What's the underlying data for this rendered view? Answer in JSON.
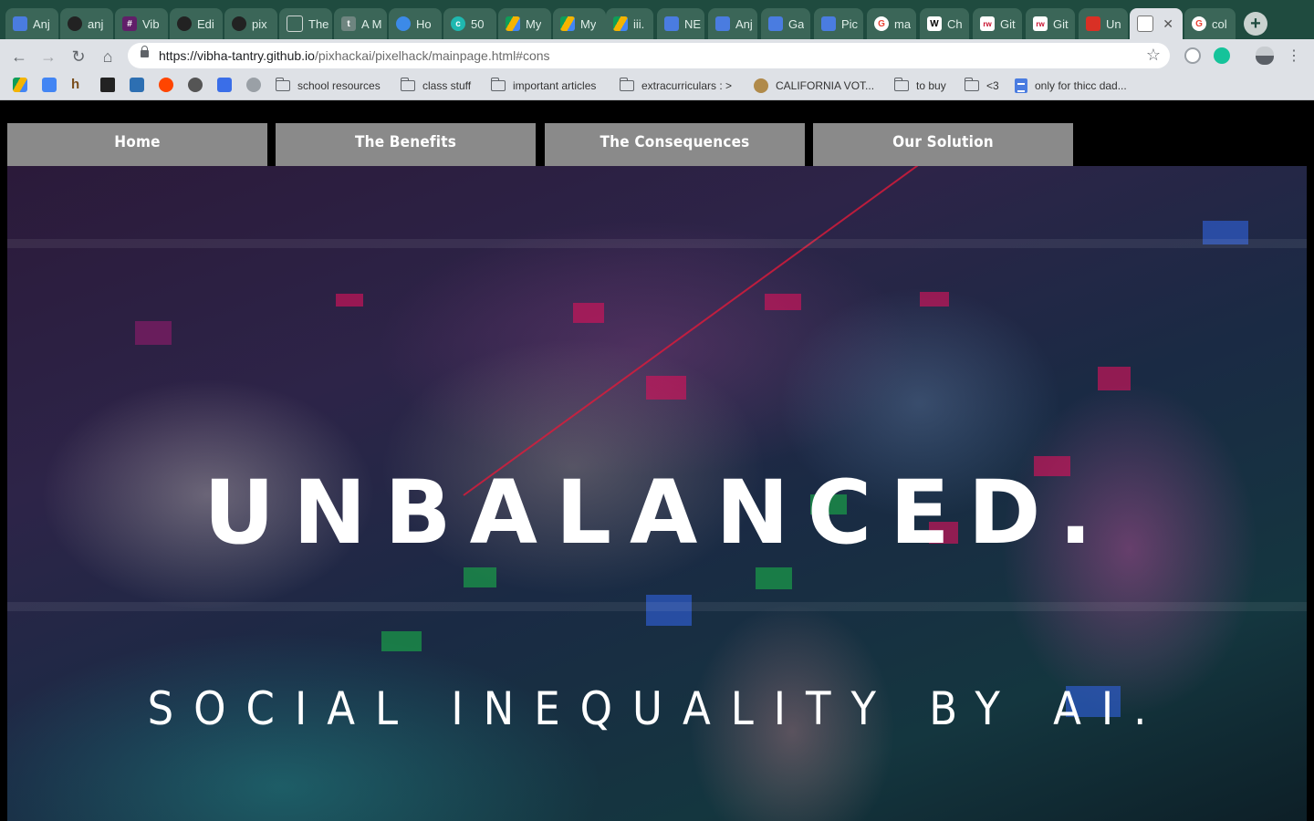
{
  "browser": {
    "tabs": [
      {
        "label": "Anj",
        "icon": "google-docs-icon",
        "color": "#4a7ce0"
      },
      {
        "label": "anj",
        "icon": "github-icon",
        "color": "#222222"
      },
      {
        "label": "Vib",
        "icon": "slack-icon",
        "color": "#611f69"
      },
      {
        "label": "Edi",
        "icon": "github-icon",
        "color": "#222222"
      },
      {
        "label": "pix",
        "icon": "github-icon",
        "color": "#222222"
      },
      {
        "label": "The",
        "icon": "page-icon",
        "color": "#9aa0a6"
      },
      {
        "label": "A M",
        "icon": "tumblr-icon",
        "color": "#8a9a95"
      },
      {
        "label": "Ho",
        "icon": "maps-icon",
        "color": "#3c8ae8"
      },
      {
        "label": "50",
        "icon": "c-icon",
        "color": "#1fb8b0"
      },
      {
        "label": "My",
        "icon": "google-drive-icon",
        "color": "#f4b400"
      },
      {
        "label": "My",
        "icon": "google-drive-icon",
        "color": "#f4b400"
      },
      {
        "label": "iii.",
        "icon": "google-drive-icon",
        "color": "#f4b400"
      },
      {
        "label": "NE",
        "icon": "google-docs-icon",
        "color": "#4a7ce0"
      },
      {
        "label": "Anj",
        "icon": "google-docs-icon",
        "color": "#4a7ce0"
      },
      {
        "label": "Ga",
        "icon": "google-docs-icon",
        "color": "#4a7ce0"
      },
      {
        "label": "Pic",
        "icon": "google-docs-icon",
        "color": "#4a7ce0"
      },
      {
        "label": "ma",
        "icon": "google-icon",
        "color": "#ea4335"
      },
      {
        "label": "Ch",
        "icon": "wikipedia-icon",
        "color": "#ffffff"
      },
      {
        "label": "Git",
        "icon": "rw-icon",
        "color": "#c8102e"
      },
      {
        "label": "Git",
        "icon": "rw-icon",
        "color": "#c8102e"
      },
      {
        "label": "Un",
        "icon": "red-app-icon",
        "color": "#d93025"
      },
      {
        "label": "",
        "icon": "page-icon",
        "color": "#9aa0a6",
        "active": true
      },
      {
        "label": "col",
        "icon": "google-icon",
        "color": "#ea4335"
      }
    ],
    "new_tab_label": "+",
    "active_tab_close": "✕",
    "url_host": "https://vibha-tantry.github.io",
    "url_path": "/pixhackai/pixelhack/mainpage.html#cons",
    "bookmarks": [
      {
        "label": "school resources",
        "type": "folder"
      },
      {
        "label": "class stuff",
        "type": "folder"
      },
      {
        "label": "important articles",
        "type": "folder"
      },
      {
        "label": "extracurriculars : >",
        "type": "folder"
      },
      {
        "label": "CALIFORNIA VOT...",
        "type": "site"
      },
      {
        "label": "to buy",
        "type": "folder"
      },
      {
        "label": "<3",
        "type": "folder"
      },
      {
        "label": "only for thicc dad...",
        "type": "doc"
      }
    ]
  },
  "site": {
    "nav": [
      "Home",
      "The Benefits",
      "The Consequences",
      "Our Solution"
    ],
    "title": "UNBALANCED.",
    "subtitle": "SOCIAL INEQUALITY BY AI."
  }
}
